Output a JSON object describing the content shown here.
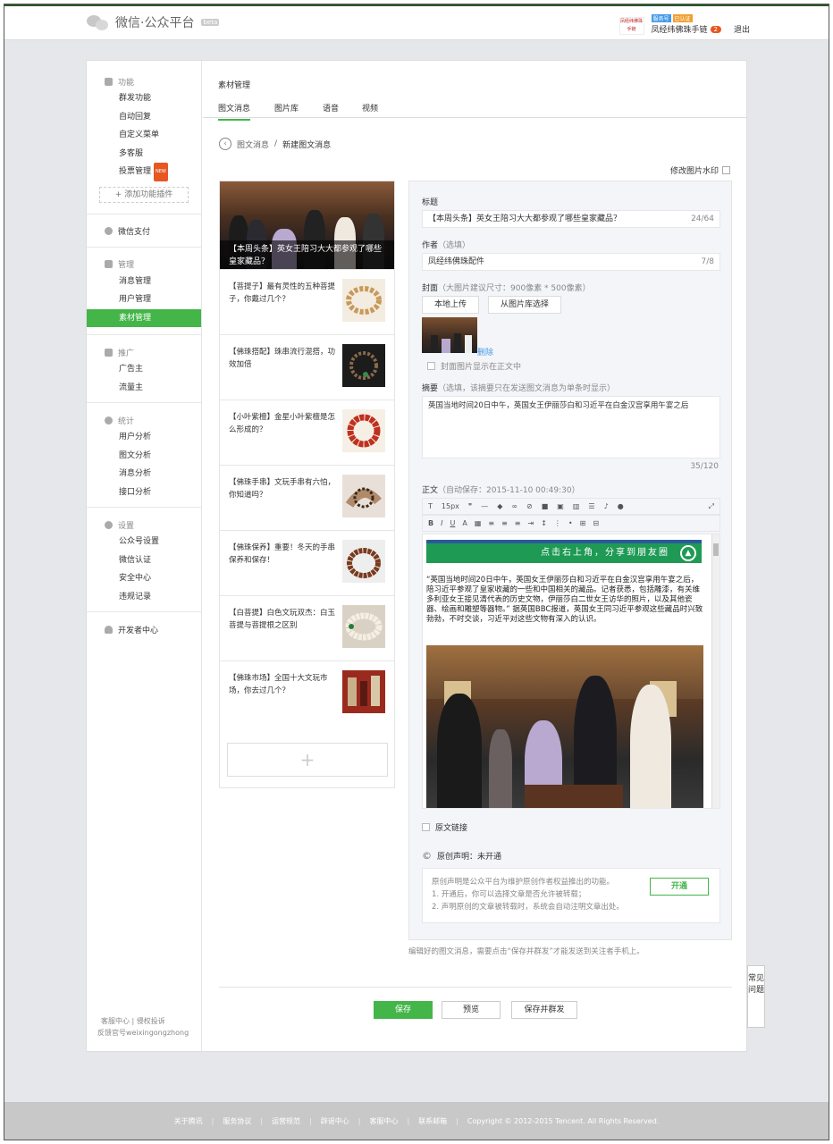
{
  "header": {
    "logo_text": "微信·公众平台",
    "logo_beta": "beta",
    "avatar_text": "凤经纬佛珠手链",
    "badge_service": "服务号",
    "badge_verified": "已认证",
    "account_name": "凤经纬佛珠手链",
    "notice_count": "2",
    "logout": "退出"
  },
  "sidebar": {
    "groups": [
      {
        "title": "功能",
        "items": [
          "群发功能",
          "自动回复",
          "自定义菜单",
          "多客服",
          "投票管理"
        ],
        "hot": "NEW",
        "add_plugin": "+ 添加功能插件"
      },
      {
        "title": "微信支付"
      },
      {
        "title": "管理",
        "items": [
          "消息管理",
          "用户管理",
          "素材管理"
        ]
      },
      {
        "title": "推广",
        "items": [
          "广告主",
          "流量主"
        ]
      },
      {
        "title": "统计",
        "items": [
          "用户分析",
          "图文分析",
          "消息分析",
          "接口分析"
        ]
      },
      {
        "title": "设置",
        "items": [
          "公众号设置",
          "微信认证",
          "安全中心",
          "违规记录"
        ]
      },
      {
        "title": "开发者中心"
      }
    ],
    "footer_line1": "客服中心 | 侵权投诉",
    "footer_line2": "反馈官号weixingongzhong"
  },
  "main": {
    "title": "素材管理",
    "tabs": [
      "图文消息",
      "图片库",
      "语音",
      "视频"
    ],
    "breadcrumb_parent": "图文消息",
    "breadcrumb_current": "新建图文消息",
    "watermark": "修改图片水印"
  },
  "articles": [
    {
      "title": "【本周头条】英女王陪习大大都参观了哪些皇家藏品？"
    },
    {
      "title": "【菩提子】最有灵性的五种菩提子，你戴过几个？"
    },
    {
      "title": "【佛珠搭配】珠串流行混搭，功效加倍"
    },
    {
      "title": "【小叶紫檀】金星小叶紫檀是怎么形成的？"
    },
    {
      "title": "【佛珠手串】文玩手串有六怕，你知道吗？"
    },
    {
      "title": "【佛珠保养】重要！冬天的手串保养和保存！"
    },
    {
      "title": "【白菩提】白色文玩双杰：白玉菩提与菩提根之区别"
    },
    {
      "title": "【佛珠市场】全国十大文玩市场，你去过几个？"
    }
  ],
  "editor": {
    "title_label": "标题",
    "title_value": "【本周头条】英女王陪习大大都参观了哪些皇家藏品？",
    "title_count": "24/64",
    "author_label": "作者",
    "author_sub": "（选填）",
    "author_value": "凤经纬佛珠配件",
    "author_count": "7/8",
    "cover_label": "封面",
    "cover_sub": "（大图片建议尺寸：900像素 * 500像素）",
    "upload_local": "本地上传",
    "upload_library": "从图片库选择",
    "cover_delete": "删除",
    "cover_show": "封面图片显示在正文中",
    "summary_label": "摘要",
    "summary_sub": "（选填，该摘要只在发送图文消息为单条时显示）",
    "summary_value": "英国当地时间20日中午，英国女王伊丽莎白和习近平在白金汉宫享用午宴之后",
    "summary_count": "35/120",
    "body_label": "正文",
    "body_sub": "（自动保存：2015-11-10 00:49:30）",
    "font_size": "15px",
    "share_text": "点击右上角，分享到朋友圈",
    "body_text": "“英国当地时间20日中午，英国女王伊丽莎白和习近平在白金汉宫享用午宴之后，陪习近平参观了皇家收藏的一些和中国相关的藏品。记者获悉，包括雕漆，有关维多利亚女王接见清代表的历史文物，伊丽莎白二世女王访华的照片，以及其他瓷器、绘画和雕塑等器物。” 据英国BBC报道，英国女王同习近平参观这些藏品时兴致勃勃，不时交谈，习近平对这些文物有深入的认识。",
    "original_link": "原文链接",
    "original_label": "原创声明：未开通",
    "original_desc1": "原创声明是公众平台为维护原创作者权益推出的功能。",
    "original_desc2": "1. 开通后，你可以选择文章是否允许被转载；",
    "original_desc3": "2. 声明原创的文章被转载时，系统会自动注明文章出处。",
    "open_btn": "开通"
  },
  "note": "编辑好的图文消息，需要点击“保存并群发”才能发送到关注者手机上。",
  "actions": {
    "save": "保存",
    "preview": "预览",
    "save_send": "保存并群发"
  },
  "faq": "常见问题",
  "footer": [
    "关于腾讯",
    "服务协议",
    "运营规范",
    "辟谣中心",
    "客服中心",
    "联系邮箱",
    "Copyright © 2012-2015 Tencent. All Rights Reserved."
  ],
  "colors": {
    "accent": "#44b549",
    "link": "#459ae9",
    "badge": "#e65722"
  }
}
